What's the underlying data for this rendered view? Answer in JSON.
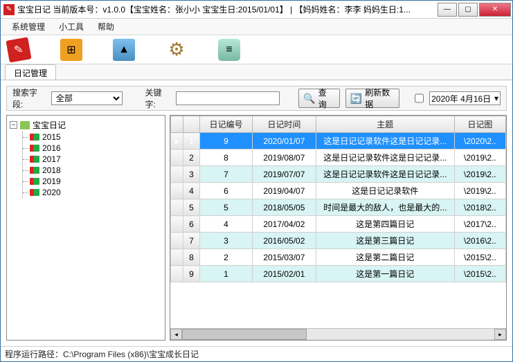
{
  "title": "宝宝日记  当前版本号：v1.0.0【宝宝姓名：张小小  宝宝生日:2015/01/01】 | 【妈妈姓名：李李  妈妈生日:1...",
  "menu": {
    "sys": "系统管理",
    "tools": "小工具",
    "help": "帮助"
  },
  "tab": "日记管理",
  "search": {
    "field_label": "搜索字段:",
    "field_value": "全部",
    "keyword_label": "关键字:",
    "keyword_value": "",
    "query_btn": "查  询",
    "refresh_btn": "刷新数据",
    "date_value": "2020年 4月16日"
  },
  "tree": {
    "root": "宝宝日记",
    "items": [
      "2015",
      "2016",
      "2017",
      "2018",
      "2019",
      "2020"
    ]
  },
  "grid": {
    "headers": {
      "no": "日记编号",
      "time": "日记时间",
      "subject": "主题",
      "img": "日记图"
    },
    "rows": [
      {
        "n": "1",
        "no": "9",
        "time": "2020/01/07",
        "subject": "这是日记记录软件这是日记记录...",
        "img": "\\2020\\2..",
        "sel": true
      },
      {
        "n": "2",
        "no": "8",
        "time": "2019/08/07",
        "subject": "这是日记记录软件这是日记记录...",
        "img": "\\2019\\2..",
        "alt": false
      },
      {
        "n": "3",
        "no": "7",
        "time": "2019/07/07",
        "subject": "这是日记记录软件这是日记记录...",
        "img": "\\2019\\2..",
        "alt": true
      },
      {
        "n": "4",
        "no": "6",
        "time": "2019/04/07",
        "subject": "这是日记记录软件",
        "img": "\\2019\\2..",
        "alt": false
      },
      {
        "n": "5",
        "no": "5",
        "time": "2018/05/05",
        "subject": "时间是最大的敌人，也是最大的...",
        "img": "\\2018\\2..",
        "alt": true
      },
      {
        "n": "6",
        "no": "4",
        "time": "2017/04/02",
        "subject": "这是第四篇日记",
        "img": "\\2017\\2..",
        "alt": false
      },
      {
        "n": "7",
        "no": "3",
        "time": "2016/05/02",
        "subject": "这是第三篇日记",
        "img": "\\2016\\2..",
        "alt": true
      },
      {
        "n": "8",
        "no": "2",
        "time": "2015/03/07",
        "subject": "这是第二篇日记",
        "img": "\\2015\\2..",
        "alt": false
      },
      {
        "n": "9",
        "no": "1",
        "time": "2015/02/01",
        "subject": "这是第一篇日记",
        "img": "\\2015\\2..",
        "alt": true
      }
    ]
  },
  "status": "程序运行路径：C:\\Program Files (x86)\\宝宝成长日记"
}
